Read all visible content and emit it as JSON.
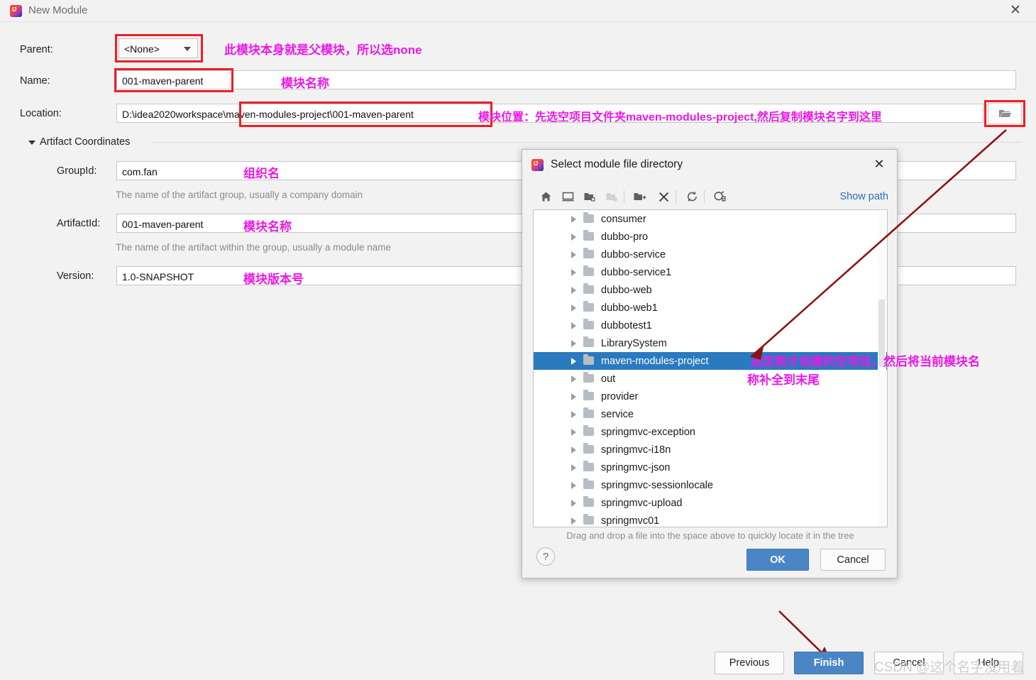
{
  "window": {
    "title": "New Module",
    "close_label": "✕",
    "logo_icon": "intellij-idea-logo"
  },
  "form": {
    "parent": {
      "label": "Parent:",
      "value": "<None>"
    },
    "name": {
      "label": "Name:",
      "value": "001-maven-parent"
    },
    "location": {
      "label": "Location:",
      "value": "D:\\idea2020workspace\\maven-modules-project\\001-maven-parent",
      "browse_icon": "folder-open-icon"
    },
    "artifact_section": {
      "label": "Artifact Coordinates"
    },
    "group_id": {
      "label": "GroupId:",
      "value": "com.fan",
      "hint": "The name of the artifact group, usually a company domain"
    },
    "artifact_id": {
      "label": "ArtifactId:",
      "value": "001-maven-parent",
      "hint": "The name of the artifact within the group, usually a module name"
    },
    "version": {
      "label": "Version:",
      "value": "1.0-SNAPSHOT"
    }
  },
  "annotations": [
    {
      "id": "parent-note",
      "text": "此模块本身就是父模块，所以选none"
    },
    {
      "id": "name-note",
      "text": "模块名称"
    },
    {
      "id": "location-note",
      "text": "模块位置：先选空项目文件夹maven-modules-project,然后复制模块名字到这里"
    },
    {
      "id": "groupid-note",
      "text": "组织名"
    },
    {
      "id": "artifactid-note",
      "text": "模块名称"
    },
    {
      "id": "version-note",
      "text": "模块版本号"
    },
    {
      "id": "tree-note-line1",
      "text": "选定刚才创建的空项目，然后将当前模块名"
    },
    {
      "id": "tree-note-line2",
      "text": "称补全到末尾"
    }
  ],
  "sub_dialog": {
    "title": "Select module file directory",
    "logo_icon": "intellij-idea-logo",
    "close_label": "✕",
    "show_path_label": "Show path",
    "toolbar_icons": [
      "home-icon",
      "desktop-icon",
      "collapse-folder-icon",
      "expand-folder-icon",
      "new-folder-icon",
      "delete-icon",
      "refresh-icon",
      "show-hidden-files-icon"
    ],
    "tree_items": [
      {
        "name": "consumer",
        "selected": false
      },
      {
        "name": "dubbo-pro",
        "selected": false
      },
      {
        "name": "dubbo-service",
        "selected": false
      },
      {
        "name": "dubbo-service1",
        "selected": false
      },
      {
        "name": "dubbo-web",
        "selected": false
      },
      {
        "name": "dubbo-web1",
        "selected": false
      },
      {
        "name": "dubbotest1",
        "selected": false
      },
      {
        "name": "LibrarySystem",
        "selected": false
      },
      {
        "name": "maven-modules-project",
        "selected": true
      },
      {
        "name": "out",
        "selected": false
      },
      {
        "name": "provider",
        "selected": false
      },
      {
        "name": "service",
        "selected": false
      },
      {
        "name": "springmvc-exception",
        "selected": false
      },
      {
        "name": "springmvc-i18n",
        "selected": false
      },
      {
        "name": "springmvc-json",
        "selected": false
      },
      {
        "name": "springmvc-sessionlocale",
        "selected": false
      },
      {
        "name": "springmvc-upload",
        "selected": false
      },
      {
        "name": "springmvc01",
        "selected": false
      }
    ],
    "drag_tip": "Drag and drop a file into the space above to quickly locate it in the tree",
    "help_label": "?",
    "ok_label": "OK",
    "cancel_label": "Cancel"
  },
  "footer": {
    "previous_label": "Previous",
    "finish_label": "Finish",
    "cancel_label": "Cancel",
    "help_label": "Help"
  },
  "watermark": {
    "text": "CSDN @这个名字沒用着"
  },
  "colors": {
    "selection_blue": "#2a7ac0",
    "primary_button": "#4a86c5",
    "annotation_magenta": "#ea19e6",
    "redbox": "#ec2024",
    "arrow_dark_red": "#8c1313",
    "link_blue": "#2a6ebb"
  }
}
